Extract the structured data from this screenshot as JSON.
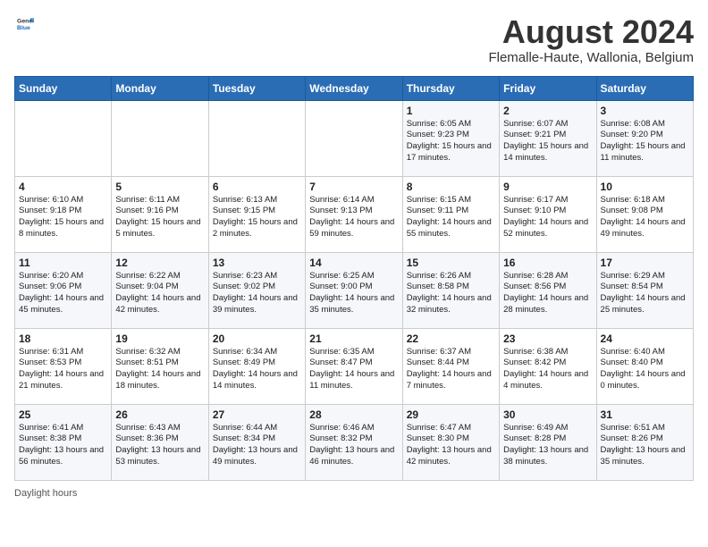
{
  "header": {
    "logo_general": "General",
    "logo_blue": "Blue",
    "main_title": "August 2024",
    "subtitle": "Flemalle-Haute, Wallonia, Belgium"
  },
  "weekdays": [
    "Sunday",
    "Monday",
    "Tuesday",
    "Wednesday",
    "Thursday",
    "Friday",
    "Saturday"
  ],
  "weeks": [
    [
      {
        "day": "",
        "sunrise": "",
        "sunset": "",
        "daylight": ""
      },
      {
        "day": "",
        "sunrise": "",
        "sunset": "",
        "daylight": ""
      },
      {
        "day": "",
        "sunrise": "",
        "sunset": "",
        "daylight": ""
      },
      {
        "day": "",
        "sunrise": "",
        "sunset": "",
        "daylight": ""
      },
      {
        "day": "1",
        "sunrise": "Sunrise: 6:05 AM",
        "sunset": "Sunset: 9:23 PM",
        "daylight": "Daylight: 15 hours and 17 minutes."
      },
      {
        "day": "2",
        "sunrise": "Sunrise: 6:07 AM",
        "sunset": "Sunset: 9:21 PM",
        "daylight": "Daylight: 15 hours and 14 minutes."
      },
      {
        "day": "3",
        "sunrise": "Sunrise: 6:08 AM",
        "sunset": "Sunset: 9:20 PM",
        "daylight": "Daylight: 15 hours and 11 minutes."
      }
    ],
    [
      {
        "day": "4",
        "sunrise": "Sunrise: 6:10 AM",
        "sunset": "Sunset: 9:18 PM",
        "daylight": "Daylight: 15 hours and 8 minutes."
      },
      {
        "day": "5",
        "sunrise": "Sunrise: 6:11 AM",
        "sunset": "Sunset: 9:16 PM",
        "daylight": "Daylight: 15 hours and 5 minutes."
      },
      {
        "day": "6",
        "sunrise": "Sunrise: 6:13 AM",
        "sunset": "Sunset: 9:15 PM",
        "daylight": "Daylight: 15 hours and 2 minutes."
      },
      {
        "day": "7",
        "sunrise": "Sunrise: 6:14 AM",
        "sunset": "Sunset: 9:13 PM",
        "daylight": "Daylight: 14 hours and 59 minutes."
      },
      {
        "day": "8",
        "sunrise": "Sunrise: 6:15 AM",
        "sunset": "Sunset: 9:11 PM",
        "daylight": "Daylight: 14 hours and 55 minutes."
      },
      {
        "day": "9",
        "sunrise": "Sunrise: 6:17 AM",
        "sunset": "Sunset: 9:10 PM",
        "daylight": "Daylight: 14 hours and 52 minutes."
      },
      {
        "day": "10",
        "sunrise": "Sunrise: 6:18 AM",
        "sunset": "Sunset: 9:08 PM",
        "daylight": "Daylight: 14 hours and 49 minutes."
      }
    ],
    [
      {
        "day": "11",
        "sunrise": "Sunrise: 6:20 AM",
        "sunset": "Sunset: 9:06 PM",
        "daylight": "Daylight: 14 hours and 45 minutes."
      },
      {
        "day": "12",
        "sunrise": "Sunrise: 6:22 AM",
        "sunset": "Sunset: 9:04 PM",
        "daylight": "Daylight: 14 hours and 42 minutes."
      },
      {
        "day": "13",
        "sunrise": "Sunrise: 6:23 AM",
        "sunset": "Sunset: 9:02 PM",
        "daylight": "Daylight: 14 hours and 39 minutes."
      },
      {
        "day": "14",
        "sunrise": "Sunrise: 6:25 AM",
        "sunset": "Sunset: 9:00 PM",
        "daylight": "Daylight: 14 hours and 35 minutes."
      },
      {
        "day": "15",
        "sunrise": "Sunrise: 6:26 AM",
        "sunset": "Sunset: 8:58 PM",
        "daylight": "Daylight: 14 hours and 32 minutes."
      },
      {
        "day": "16",
        "sunrise": "Sunrise: 6:28 AM",
        "sunset": "Sunset: 8:56 PM",
        "daylight": "Daylight: 14 hours and 28 minutes."
      },
      {
        "day": "17",
        "sunrise": "Sunrise: 6:29 AM",
        "sunset": "Sunset: 8:54 PM",
        "daylight": "Daylight: 14 hours and 25 minutes."
      }
    ],
    [
      {
        "day": "18",
        "sunrise": "Sunrise: 6:31 AM",
        "sunset": "Sunset: 8:53 PM",
        "daylight": "Daylight: 14 hours and 21 minutes."
      },
      {
        "day": "19",
        "sunrise": "Sunrise: 6:32 AM",
        "sunset": "Sunset: 8:51 PM",
        "daylight": "Daylight: 14 hours and 18 minutes."
      },
      {
        "day": "20",
        "sunrise": "Sunrise: 6:34 AM",
        "sunset": "Sunset: 8:49 PM",
        "daylight": "Daylight: 14 hours and 14 minutes."
      },
      {
        "day": "21",
        "sunrise": "Sunrise: 6:35 AM",
        "sunset": "Sunset: 8:47 PM",
        "daylight": "Daylight: 14 hours and 11 minutes."
      },
      {
        "day": "22",
        "sunrise": "Sunrise: 6:37 AM",
        "sunset": "Sunset: 8:44 PM",
        "daylight": "Daylight: 14 hours and 7 minutes."
      },
      {
        "day": "23",
        "sunrise": "Sunrise: 6:38 AM",
        "sunset": "Sunset: 8:42 PM",
        "daylight": "Daylight: 14 hours and 4 minutes."
      },
      {
        "day": "24",
        "sunrise": "Sunrise: 6:40 AM",
        "sunset": "Sunset: 8:40 PM",
        "daylight": "Daylight: 14 hours and 0 minutes."
      }
    ],
    [
      {
        "day": "25",
        "sunrise": "Sunrise: 6:41 AM",
        "sunset": "Sunset: 8:38 PM",
        "daylight": "Daylight: 13 hours and 56 minutes."
      },
      {
        "day": "26",
        "sunrise": "Sunrise: 6:43 AM",
        "sunset": "Sunset: 8:36 PM",
        "daylight": "Daylight: 13 hours and 53 minutes."
      },
      {
        "day": "27",
        "sunrise": "Sunrise: 6:44 AM",
        "sunset": "Sunset: 8:34 PM",
        "daylight": "Daylight: 13 hours and 49 minutes."
      },
      {
        "day": "28",
        "sunrise": "Sunrise: 6:46 AM",
        "sunset": "Sunset: 8:32 PM",
        "daylight": "Daylight: 13 hours and 46 minutes."
      },
      {
        "day": "29",
        "sunrise": "Sunrise: 6:47 AM",
        "sunset": "Sunset: 8:30 PM",
        "daylight": "Daylight: 13 hours and 42 minutes."
      },
      {
        "day": "30",
        "sunrise": "Sunrise: 6:49 AM",
        "sunset": "Sunset: 8:28 PM",
        "daylight": "Daylight: 13 hours and 38 minutes."
      },
      {
        "day": "31",
        "sunrise": "Sunrise: 6:51 AM",
        "sunset": "Sunset: 8:26 PM",
        "daylight": "Daylight: 13 hours and 35 minutes."
      }
    ]
  ],
  "footer": {
    "daylight_label": "Daylight hours"
  }
}
